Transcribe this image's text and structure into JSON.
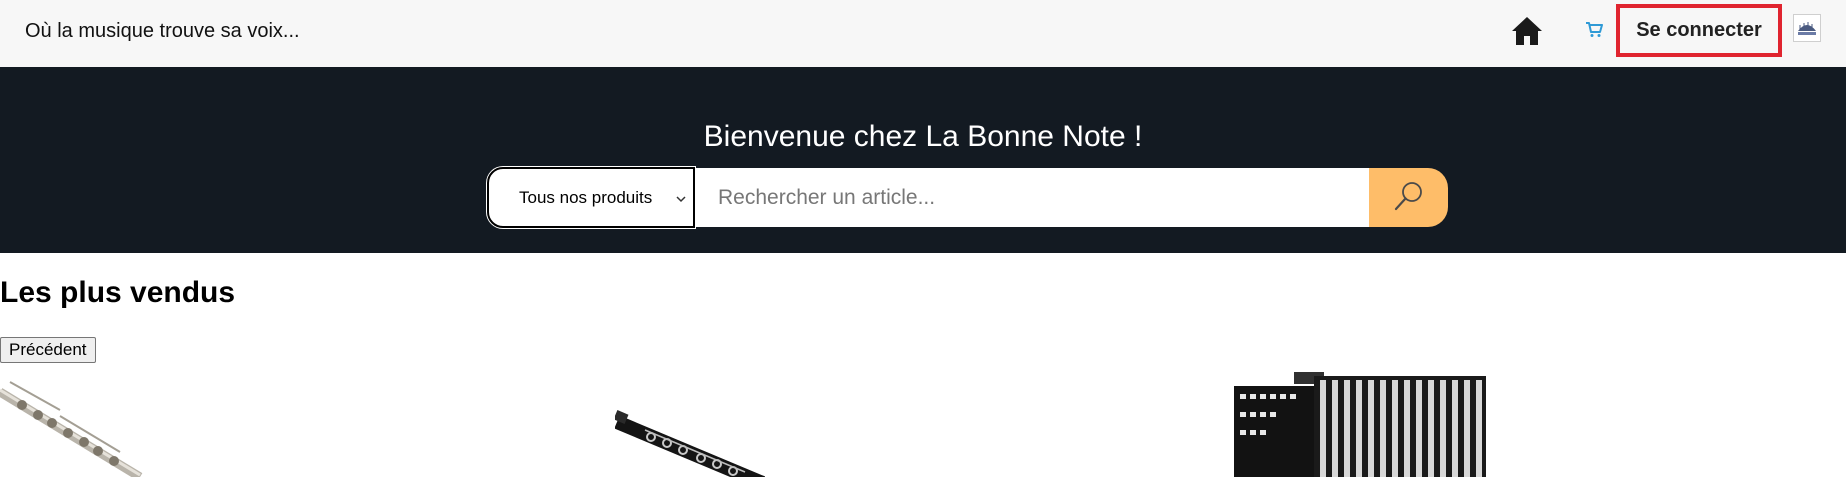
{
  "header": {
    "tagline": "Où la musique trouve sa voix...",
    "home_icon": "home-icon",
    "cart_icon": "cart-icon",
    "login_label": "Se connecter",
    "logo_icon": "site-logo-icon",
    "login_highlight_color": "#e0242f"
  },
  "hero": {
    "title": "Bienvenue chez La Bonne Note !",
    "category_selected": "Tous nos produits",
    "search_placeholder": "Rechercher un article...",
    "search_icon": "magnifier-icon",
    "background_color": "#131a22",
    "search_button_color": "#febd69"
  },
  "bestsellers": {
    "title": "Les plus vendus",
    "prev_label": "Précédent",
    "products": [
      {
        "image": "flute-image"
      },
      {
        "image": "clarinet-image"
      },
      {
        "image": "accordion-image"
      }
    ]
  }
}
